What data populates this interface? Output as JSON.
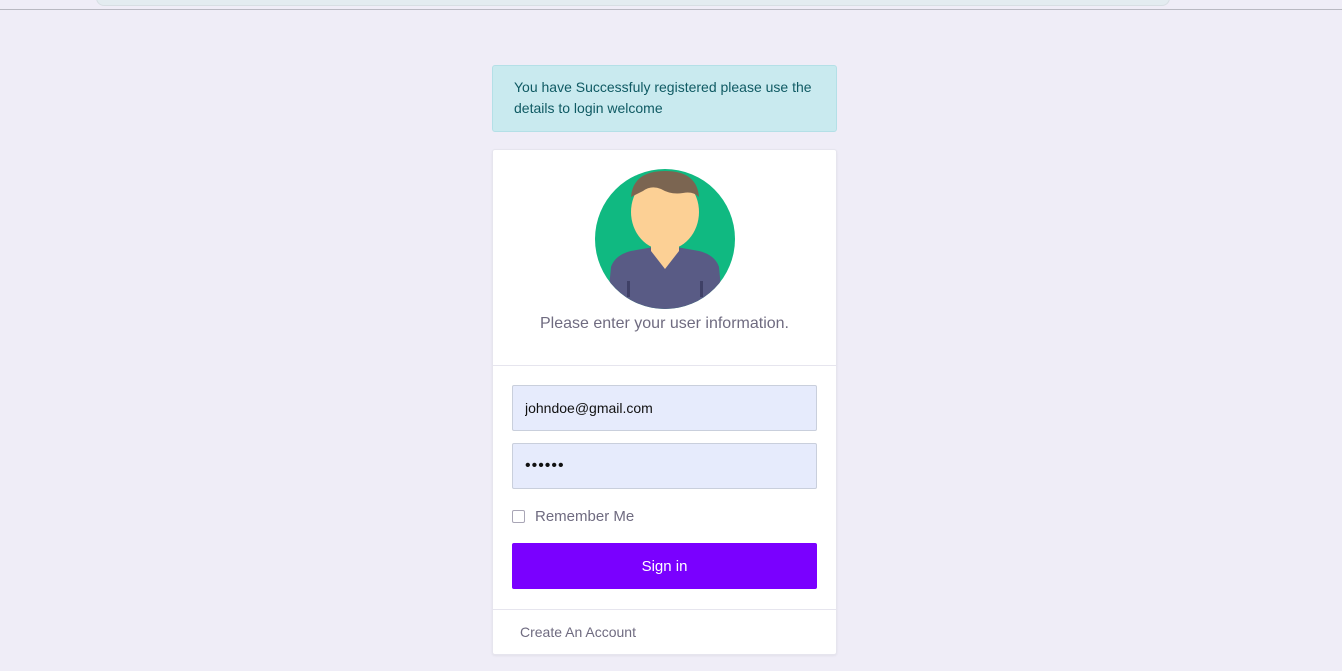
{
  "alert": {
    "message": "You have Successfuly registered please use the details to login welcome"
  },
  "login": {
    "subtitle": "Please enter your user information.",
    "email_value": "johndoe@gmail.com",
    "password_value": "••••••",
    "remember_label": "Remember Me",
    "remember_checked": false,
    "signin_label": "Sign in",
    "create_account_label": "Create An Account"
  },
  "colors": {
    "background": "#efedf7",
    "alert_bg": "#c9eaef",
    "alert_text": "#0f5a63",
    "button": "#7a00ff",
    "input_bg": "#e6ebfc",
    "avatar_circle": "#10b981",
    "avatar_shirt": "#595b85",
    "avatar_skin": "#fcd095",
    "avatar_hair": "#7b6551"
  },
  "icons": {
    "avatar": "user-avatar-icon"
  }
}
